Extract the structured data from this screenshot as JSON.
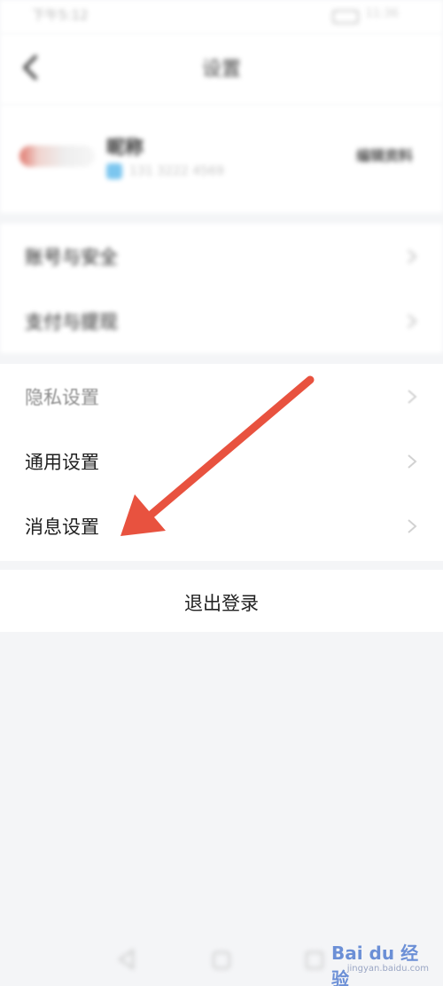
{
  "status_bar": {
    "time": "下午5:12",
    "battery_pct": "11:36"
  },
  "header": {
    "title": "设置",
    "back_icon": "chevron-left-icon"
  },
  "profile": {
    "name": "昵称",
    "account_id": "131 3222 4569",
    "edit_label": "编辑资料"
  },
  "groups": [
    {
      "items": [
        {
          "label": "账号与安全"
        },
        {
          "label": "支付与提现"
        }
      ]
    },
    {
      "items": [
        {
          "label": "隐私设置"
        },
        {
          "label": "通用设置"
        },
        {
          "label": "消息设置"
        }
      ]
    }
  ],
  "logout": {
    "label": "退出登录"
  },
  "nav_bar": {
    "back_icon": "triangle-back-icon",
    "home_icon": "circle-home-icon",
    "recent_icon": "square-recent-icon"
  },
  "annotation": {
    "arrow_color": "#e8523f",
    "target": "消息设置"
  },
  "watermark": {
    "brand": "Bai du 经验",
    "url": "jingyan.baidu.com"
  },
  "colors": {
    "background": "#f4f5f7",
    "card": "#ffffff",
    "accent_arrow": "#e8523f"
  }
}
